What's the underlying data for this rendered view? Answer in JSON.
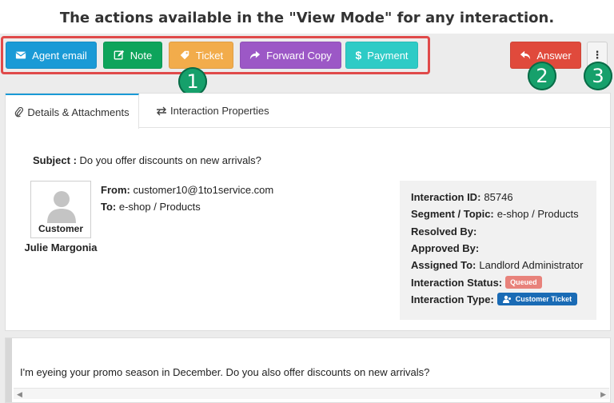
{
  "header": {
    "title": "The actions available in the \"View Mode\" for any interaction."
  },
  "toolbar": {
    "agent_email": "Agent email",
    "note": "Note",
    "ticket": "Ticket",
    "forward_copy": "Forward Copy",
    "payment": "Payment",
    "answer": "Answer",
    "more": "⋮"
  },
  "callouts": {
    "one": "1",
    "two": "2",
    "three": "3"
  },
  "tabs": {
    "details": "Details & Attachments",
    "properties": "Interaction Properties"
  },
  "message": {
    "subject_label": "Subject :",
    "subject": "Do you offer discounts on new arrivals?",
    "from_label": "From:",
    "from": "customer10@1to1service.com",
    "to_label": "To:",
    "to": "e-shop / Products",
    "body": "I'm eyeing your promo season in December. Do you also offer discounts on new arrivals?"
  },
  "customer": {
    "avatar_label": "Customer",
    "name": "Julie Margonia"
  },
  "properties": {
    "id_label": "Interaction ID:",
    "id": "85746",
    "segment_label": "Segment / Topic:",
    "segment": "e-shop / Products",
    "resolved_label": "Resolved By:",
    "approved_label": "Approved By:",
    "assigned_label": "Assigned To:",
    "assigned": "Landlord Administrator",
    "status_label": "Interaction Status:",
    "status": "Queued",
    "type_label": "Interaction Type:",
    "type": "Customer Ticket"
  },
  "colors": {
    "email": "#1a9ad6",
    "note": "#0ea45b",
    "ticket": "#f2ac4b",
    "forward": "#9c58c6",
    "payment": "#2ecbc6",
    "answer": "#e04a3c",
    "callout": "#16a06b",
    "highlight_box": "#e04a4a"
  }
}
